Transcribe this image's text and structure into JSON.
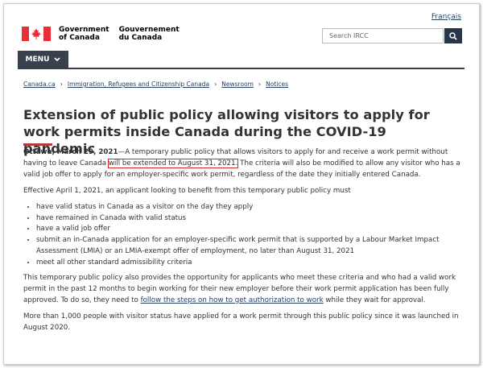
{
  "header": {
    "language_link": "Français",
    "wordmark_en": [
      "Government",
      "of Canada"
    ],
    "wordmark_fr": [
      "Gouvernement",
      "du Canada"
    ],
    "search_placeholder": "Search IRCC",
    "menu_label": "MENU"
  },
  "breadcrumb": [
    "Canada.ca",
    "Immigration, Refugees and Citizenship Canada",
    "Newsroom",
    "Notices"
  ],
  "article": {
    "title": "Extension of public policy allowing visitors to apply for work permits inside Canada during the COVID-19 pandemic",
    "dateline": "Ottawa, March 29, 2021",
    "para1_a": "—A temporary public policy that allows visitors to apply for and receive a work permit without having to leave Canada ",
    "para1_highlight": "will be extended to August 31, 2021.",
    "para1_b": " The criteria will also be modified to allow any visitor who has a valid job offer to apply for an employer-specific work permit, regardless of the date they initially entered Canada.",
    "para2": "Effective April 1, 2021, an applicant looking to benefit from this temporary public policy must",
    "bullets": [
      "have valid status in Canada as a visitor on the day they apply",
      "have remained in Canada with valid status",
      "have a valid job offer",
      "submit an in-Canada application for an employer-specific work permit that is supported by a Labour Market Impact Assessment (LMIA) or an LMIA-exempt offer of employment, no later than August 31, 2021",
      "meet all other standard admissibility criteria"
    ],
    "para3_a": "This temporary public policy also provides the opportunity for applicants who meet these criteria and who had a valid work permit in the past 12 months to begin working for their new employer before their work permit application has been fully approved. To do so, they need to ",
    "para3_link": "follow the steps on how to get authorization to work",
    "para3_b": " while they wait for approval.",
    "para4": "More than 1,000 people with visitor status have applied for a work permit through this public policy since it was launched in August 2020."
  },
  "colors": {
    "accent_red": "#d4272e",
    "menu_bg": "#38414d",
    "link": "#284162",
    "search_button": "#26374a"
  },
  "icons": {
    "flag": "canada-flag-icon",
    "search": "search-icon",
    "menu": "chevron-down-icon"
  }
}
